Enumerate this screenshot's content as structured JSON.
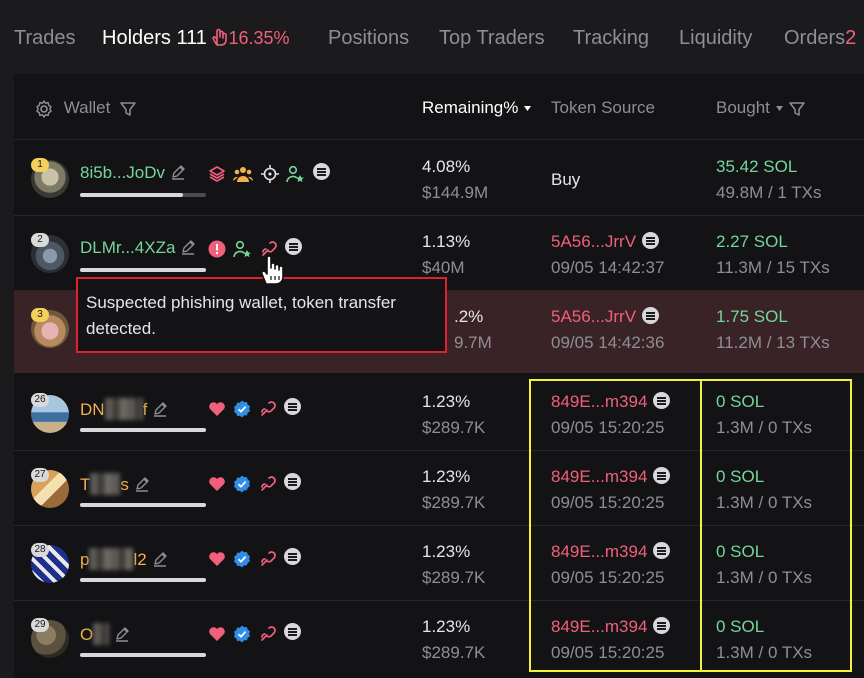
{
  "tabs": [
    {
      "label": "Trades"
    },
    {
      "label": "Holders 111",
      "pct": "16.35%"
    },
    {
      "label": "Positions"
    },
    {
      "label": "Top Traders"
    },
    {
      "label": "Tracking"
    },
    {
      "label": "Liquidity"
    },
    {
      "label": "Orders",
      "count": "2"
    }
  ],
  "header": {
    "wallet": "Wallet",
    "remaining": "Remaining%",
    "token_source": "Token Source",
    "bought": "Bought"
  },
  "rows": [
    {
      "rank": "1",
      "wallet": "8i5b...JoDv",
      "remaining_pct": "4.08%",
      "remaining_usd": "$144.9M",
      "source": "Buy",
      "source_time": "",
      "bought_sol": "35.42 SOL",
      "bought_detail": "49.8M / 1 TXs",
      "bar_fill": 0.82
    },
    {
      "rank": "2",
      "wallet": "DLMr...4XZa",
      "remaining_pct": "1.13%",
      "remaining_usd": "$40M",
      "source": "5A56...JrrV",
      "source_time": "09/05 14:42:37",
      "bought_sol": "2.27 SOL",
      "bought_detail": "11.3M / 15 TXs",
      "bar_fill": 1.0
    },
    {
      "rank": "3",
      "wallet": "",
      "remaining_pct": ".2%",
      "remaining_usd": "9.7M",
      "source": "5A56...JrrV",
      "source_time": "09/05 14:42:36",
      "bought_sol": "1.75 SOL",
      "bought_detail": "11.2M / 13 TXs",
      "bar_fill": 1.0
    },
    {
      "rank": "26",
      "wallet_pre": "DN",
      "wallet_post": "f",
      "remaining_pct": "1.23%",
      "remaining_usd": "$289.7K",
      "source": "849E...m394",
      "source_time": "09/05 15:20:25",
      "bought_sol": "0 SOL",
      "bought_detail": "1.3M / 0 TXs",
      "bar_fill": 1.0
    },
    {
      "rank": "27",
      "wallet_pre": "T",
      "wallet_post": "s",
      "remaining_pct": "1.23%",
      "remaining_usd": "$289.7K",
      "source": "849E...m394",
      "source_time": "09/05 15:20:25",
      "bought_sol": "0 SOL",
      "bought_detail": "1.3M / 0 TXs",
      "bar_fill": 1.0
    },
    {
      "rank": "28",
      "wallet_pre": "p",
      "wallet_post": "l2",
      "remaining_pct": "1.23%",
      "remaining_usd": "$289.7K",
      "source": "849E...m394",
      "source_time": "09/05 15:20:25",
      "bought_sol": "0 SOL",
      "bought_detail": "1.3M / 0 TXs",
      "bar_fill": 1.0
    },
    {
      "rank": "29",
      "wallet_pre": "O",
      "wallet_post": "",
      "remaining_pct": "1.23%",
      "remaining_usd": "$289.7K",
      "source": "849E...m394",
      "source_time": "09/05 15:20:25",
      "bought_sol": "0 SOL",
      "bought_detail": "1.3M / 0 TXs",
      "bar_fill": 1.0
    }
  ],
  "tooltip": {
    "text": "Suspected phishing wallet, token transfer detected."
  },
  "colors": {
    "accent_red": "#f0607a",
    "green": "#75d69c",
    "orange": "#f1b14a",
    "highlight_yellow": "#f6f03a",
    "alert_red": "#e0212b"
  }
}
